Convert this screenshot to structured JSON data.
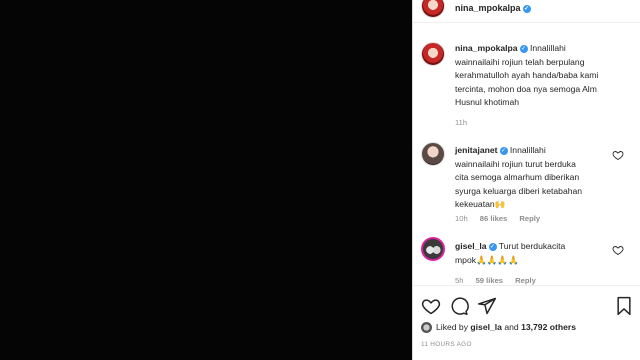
{
  "header": {
    "username": "nina_mpokalpa"
  },
  "caption": {
    "username": "nina_mpokalpa",
    "text_line1": "Innalillahi",
    "text_line2": "wainnailaihi rojiun telah berpulang",
    "text_line3": "kerahmatulloh ayah handa/baba kami",
    "text_line4": "tercinta, mohon doa nya semoga Alm",
    "text_line5": "Husnul khotimah",
    "time": "11h"
  },
  "comments": [
    {
      "username": "jenitajanet",
      "line1": "Innalillahi",
      "line2": "wainnailaihi rojiun turut berduka",
      "line3": "cita semoga almarhum diberikan",
      "line4": "syurga keluarga diberi ketabahan",
      "line5": "kekeuatan🙌",
      "time": "10h",
      "likes": "86 likes",
      "reply": "Reply"
    },
    {
      "username": "gisel_la",
      "line1": "Turut berdukacita",
      "line2": "mpok🙏🙏🙏🙏",
      "time": "5h",
      "likes": "59 likes",
      "reply": "Reply"
    }
  ],
  "likes_summary": {
    "prefix": "Liked by",
    "user": "gisel_la",
    "joiner": "and",
    "others": "13,792 others"
  },
  "time_ago": "11 HOURS AGO",
  "icons": [
    "heart-icon",
    "comment-icon",
    "share-icon",
    "bookmark-icon",
    "verified-icon"
  ]
}
